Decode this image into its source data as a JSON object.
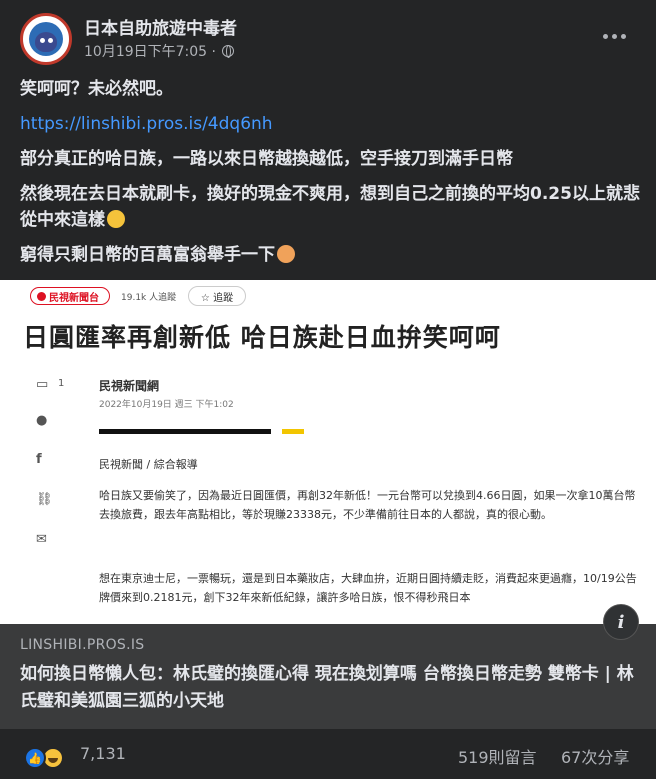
{
  "post": {
    "page_name": "日本自助旅遊中毒者",
    "timestamp": "10月19日下午7:05 ·",
    "lines": [
      "笑呵呵？未必然吧。",
      "https://linshibi.pros.is/4dq6nh",
      "部分真正的哈日族，一路以來日幣越換越低，空手接刀到滿手日幣",
      "然後現在去日本就刷卡，換好的現金不爽用，想到自己之前換的平均0.25以上就悲從中來這樣",
      "窮得只剩日幣的百萬富翁舉手一下"
    ]
  },
  "preview": {
    "outlet_logo": "民視新聞台",
    "follower_count": "19.1k 人追蹤",
    "follow_button": "☆ 追蹤",
    "headline": "日圓匯率再創新低 哈日族赴日血拚笑呵呵",
    "comment_count": "1",
    "source": "民視新聞網",
    "date": "2022年10月19日 週三 下午1:02",
    "section": "民視新聞 / 綜合報導",
    "paragraph1": "哈日族又要偷笑了，因為最近日圓匯價，再創32年新低！一元台幣可以兌換到4.66日圓，如果一次拿10萬台幣去換旅費，跟去年高點相比，等於現賺23338元，不少準備前往日本的人都說，真的很心動。",
    "paragraph2": "想在東京迪士尼，一票暢玩，還是到日本藥妝店，大肆血拚，近期日圓持續走貶，消費起來更過癮，10/19公告牌價來到0.2181元，創下32年來新低紀錄，讓許多哈日族，恨不得秒飛日本"
  },
  "link_card": {
    "domain": "LINSHIBI.PROS.IS",
    "title": "如何換日幣懶人包：林氏璧的換匯心得 現在換划算嗎 台幣換日幣走勢 雙幣卡 | 林氏璧和美狐園三狐的小天地"
  },
  "footer": {
    "reaction_count": "7,131",
    "comments": "519則留言",
    "shares": "67次分享"
  },
  "icons": {
    "more": "more-horizontal-icon",
    "privacy": "globe-icon",
    "info": "info-icon",
    "like": "like-reaction-icon",
    "haha": "haha-reaction-icon"
  },
  "colors": {
    "background": "#242526",
    "link": "#4599ff",
    "card": "#3a3b3c",
    "like_blue": "#1b74e4"
  }
}
